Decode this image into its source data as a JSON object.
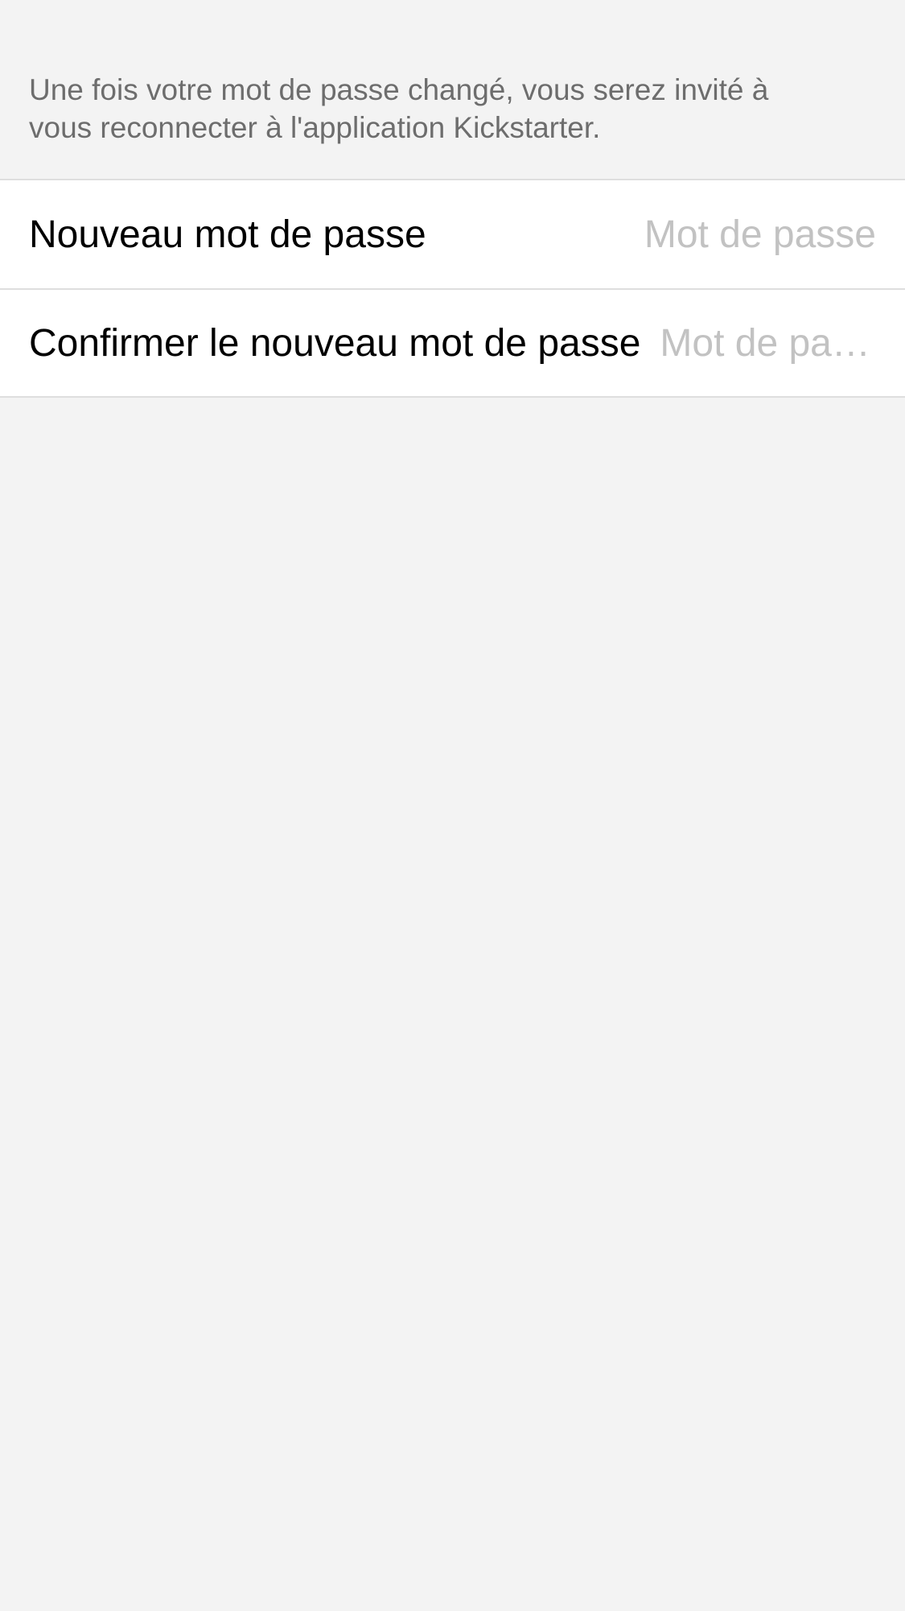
{
  "notice": {
    "text": "Une fois votre mot de passe changé, vous serez invité à\nvous reconnecter à l'application Kickstarter."
  },
  "form": {
    "new_password": {
      "label": "Nouveau mot de passe",
      "placeholder": "Mot de passe",
      "value": ""
    },
    "confirm_password": {
      "label": "Confirmer le nouveau mot de passe",
      "placeholder": "Mot de passe",
      "value": ""
    }
  },
  "colors": {
    "background": "#f3f3f3",
    "row_background": "#ffffff",
    "divider": "#dedede",
    "notice_text": "#6d6d6d",
    "label_text": "#000000",
    "placeholder_text": "#c2c2c2"
  }
}
